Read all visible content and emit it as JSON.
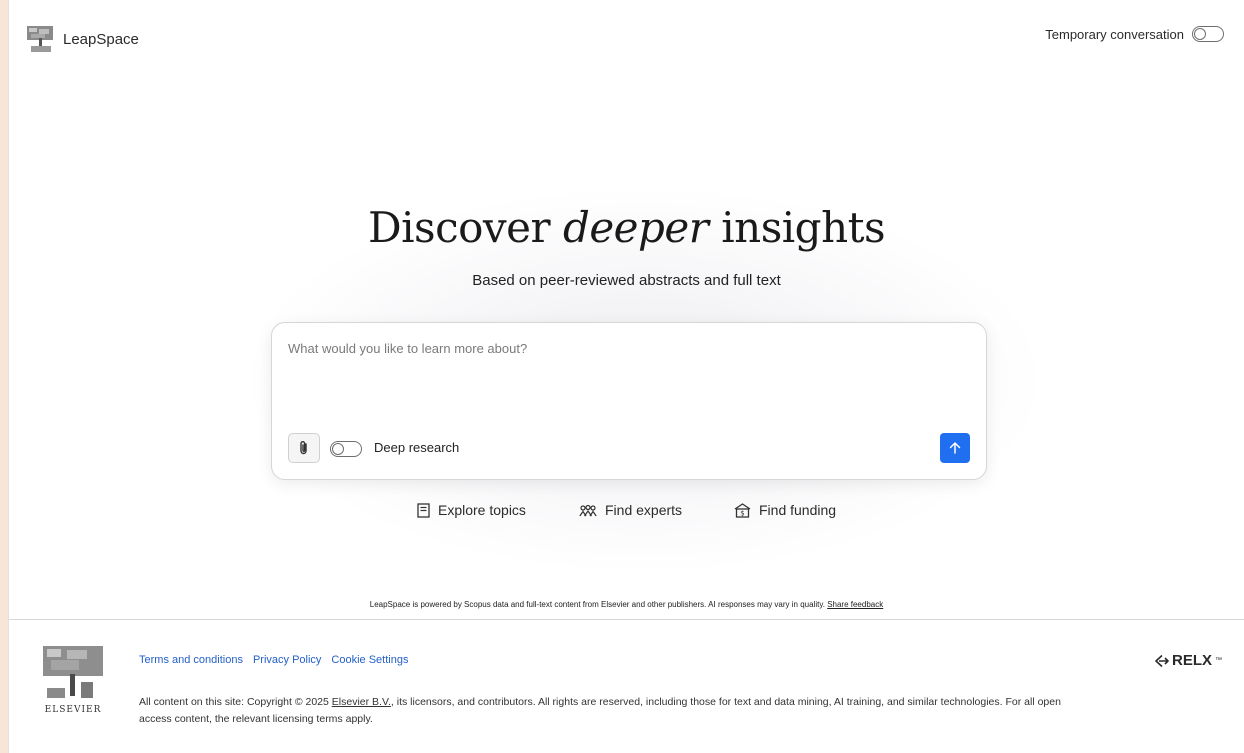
{
  "header": {
    "brand": "LeapSpace",
    "temporary_label": "Temporary conversation",
    "temporary_on": false
  },
  "hero": {
    "title_before": "Discover ",
    "title_emphasis": "deeper",
    "title_after": " insights",
    "subtitle": "Based on peer-reviewed abstracts and full text"
  },
  "search": {
    "placeholder": "What would you like to learn more about?",
    "value": "",
    "deep_research_label": "Deep research",
    "deep_research_on": false,
    "accent_color": "#1f6ff0"
  },
  "quick_links": [
    {
      "label": "Explore topics",
      "icon": "document-icon"
    },
    {
      "label": "Find experts",
      "icon": "people-icon"
    },
    {
      "label": "Find funding",
      "icon": "funding-icon"
    }
  ],
  "disclaimer": {
    "text": "LeapSpace is powered by Scopus data and full-text content from Elsevier and other publishers. AI responses may vary in quality. ",
    "link": "Share feedback"
  },
  "footer": {
    "links": [
      "Terms and conditions",
      "Privacy Policy",
      "Cookie Settings"
    ],
    "copyright_before": "All content on this site: Copyright © 2025 ",
    "copyright_link": "Elsevier B.V.",
    "copyright_after": ", its licensors, and contributors. All rights are reserved, including those for text and data mining, AI training, and similar technologies. For all open access content, the relevant licensing terms apply.",
    "elsevier_wordmark": "ELSEVIER",
    "relx": "RELX",
    "relx_tm": "™",
    "link_color": "#2560c8"
  }
}
